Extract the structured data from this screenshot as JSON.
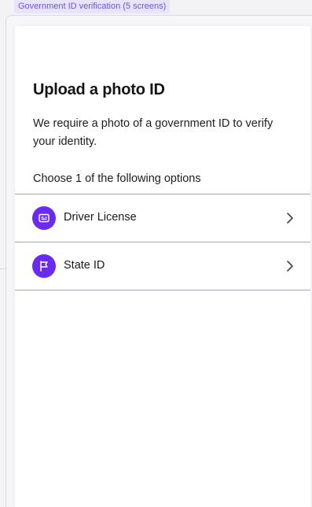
{
  "flow": {
    "label": "Government ID verification (5 screens)"
  },
  "screen": {
    "title": "Upload a photo ID",
    "description": "We require a photo of a government ID to verify your identity.",
    "choose_prompt": "Choose 1 of the following options",
    "options": [
      {
        "label": "Driver License",
        "icon": "id-card-icon"
      },
      {
        "label": "State ID",
        "icon": "flag-icon"
      }
    ]
  },
  "colors": {
    "accent": "#6a2bf0",
    "flow_label_text": "#6a54e6",
    "flow_label_bg": "#e7e4fb",
    "divider": "#a8a8b0"
  }
}
